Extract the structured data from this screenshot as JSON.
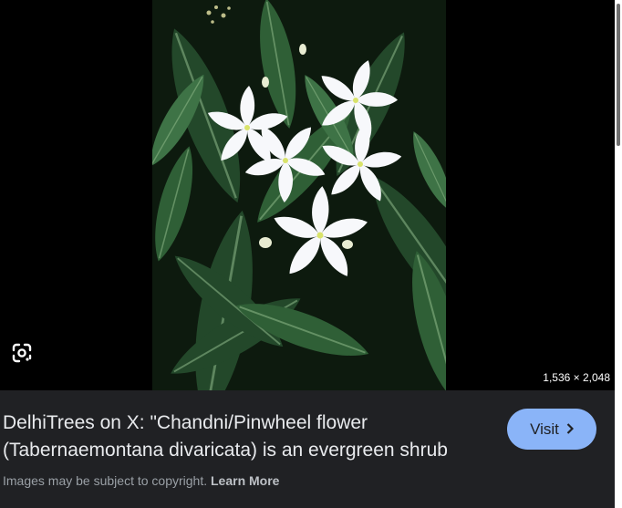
{
  "preview": {
    "image_dimensions": "1,536 × 2,048",
    "lens_icon": "google-lens-icon"
  },
  "result": {
    "title": "DelhiTrees on X: \"Chandni/Pinwheel flower (Tabernaemontana divaricata) is an evergreen shrub",
    "visit_label": "Visit",
    "visit_icon": "chevron-right-icon"
  },
  "footer": {
    "copyright_text": "Images may be subject to copyright.",
    "learn_more_label": "Learn More"
  },
  "colors": {
    "page_background": "#202124",
    "preview_background": "#000000",
    "visit_button": "#8ab4f8",
    "title_text": "#e8eaed",
    "muted_text": "#9aa0a6"
  }
}
